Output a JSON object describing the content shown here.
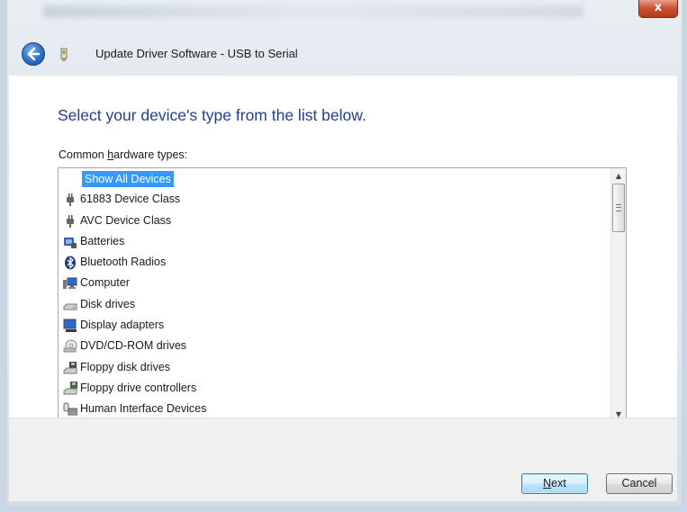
{
  "window": {
    "title": "Update Driver Software - USB to Serial",
    "close_label": "x"
  },
  "main": {
    "heading": "Select your device's type from the list below.",
    "list_label_prefix": "Common ",
    "list_label_accel": "h",
    "list_label_rest": "ardware types:",
    "items": [
      {
        "label": "Show All Devices",
        "icon": "none",
        "selected": true
      },
      {
        "label": "61883 Device Class",
        "icon": "plug-icon"
      },
      {
        "label": "AVC Device Class",
        "icon": "plug-icon"
      },
      {
        "label": "Batteries",
        "icon": "battery-icon"
      },
      {
        "label": "Bluetooth Radios",
        "icon": "bluetooth-icon"
      },
      {
        "label": "Computer",
        "icon": "computer-icon"
      },
      {
        "label": "Disk drives",
        "icon": "disk-drive-icon"
      },
      {
        "label": "Display adapters",
        "icon": "display-adapter-icon"
      },
      {
        "label": "DVD/CD-ROM drives",
        "icon": "dvd-drive-icon"
      },
      {
        "label": "Floppy disk drives",
        "icon": "floppy-drive-icon"
      },
      {
        "label": "Floppy drive controllers",
        "icon": "floppy-controller-icon"
      },
      {
        "label": "Human Interface Devices",
        "icon": "hid-icon"
      }
    ]
  },
  "footer": {
    "next_accel": "N",
    "next_rest": "ext",
    "cancel_label": "Cancel"
  },
  "colors": {
    "heading": "#1f3f8f",
    "selection": "#3399ff"
  }
}
